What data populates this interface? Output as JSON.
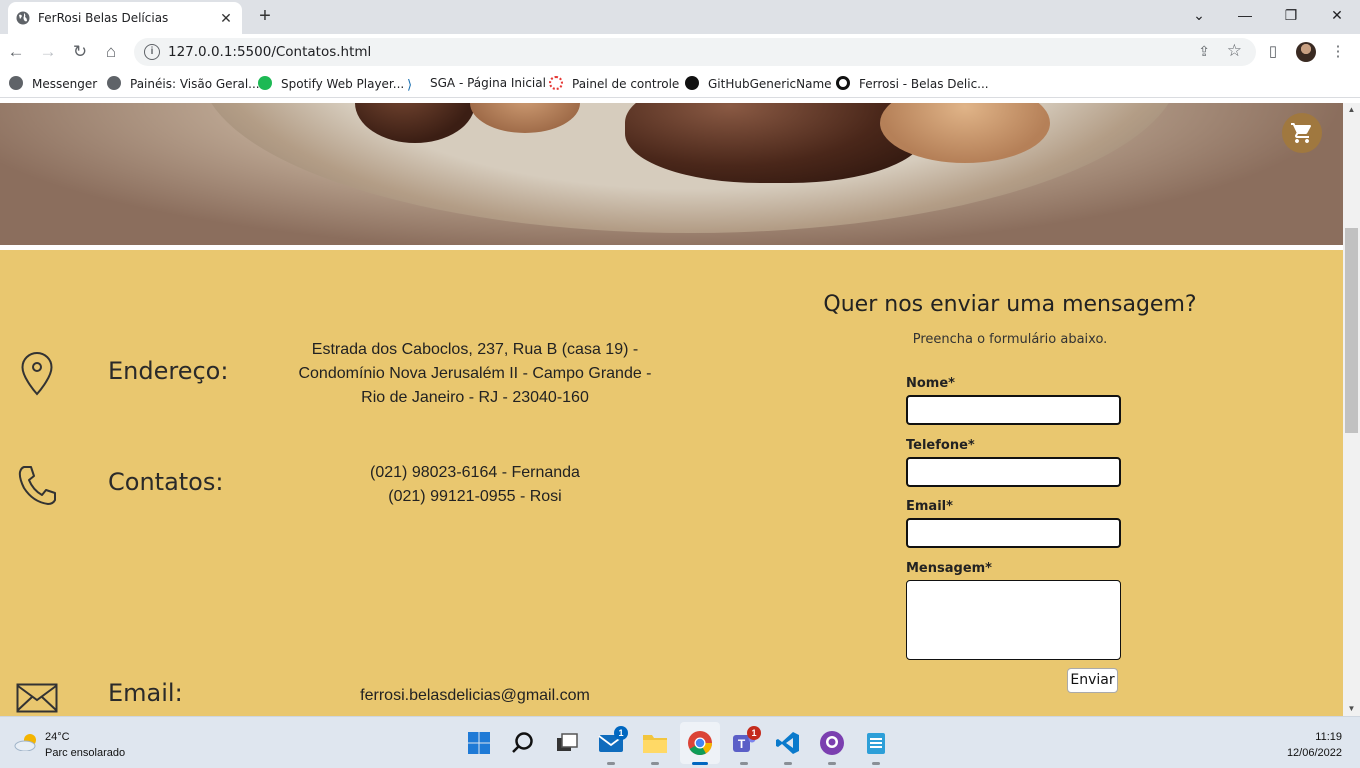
{
  "browser": {
    "tab_title": "FerRosi Belas Delícias",
    "tab_close": "✕",
    "new_tab": "+",
    "url": "127.0.0.1:5500/Contatos.html",
    "window_controls": {
      "dropdown": "⌄",
      "minimize": "—",
      "restore": "❐",
      "close": "✕"
    }
  },
  "bookmarks": [
    {
      "label": "Messenger",
      "icon": "globe-icon",
      "color": "#5f6368"
    },
    {
      "label": "Painéis: Visão Geral...",
      "icon": "globe-icon",
      "color": "#5f6368"
    },
    {
      "label": "Spotify Web Player...",
      "icon": "spotify-icon",
      "color": "#1db954"
    },
    {
      "label": "SGA - Página Inicial",
      "icon": "sga-icon",
      "color": "#1a6fb0"
    },
    {
      "label": "Painel de controle",
      "icon": "dotted-ring-icon",
      "color": "#e53935"
    },
    {
      "label": "GitHubGenericName",
      "icon": "github-icon",
      "color": "#111111"
    },
    {
      "label": "Ferrosi - Belas Delic...",
      "icon": "ferrosi-icon",
      "color": "#111111"
    }
  ],
  "contact": {
    "address_label": "Endereço:",
    "address_value": "Estrada dos Caboclos, 237, Rua B (casa 19) - Condomínio Nova Jerusalém II - Campo Grande - Rio de Janeiro - RJ - 23040-160",
    "phone_label": "Contatos:",
    "phone_line1": "(021) 98023-6164 - Fernanda",
    "phone_line2": "(021) 99121-0955 - Rosi",
    "email_label": "Email:",
    "email_value": "ferrosi.belasdelicias@gmail.com"
  },
  "form": {
    "title": "Quer nos enviar uma mensagem?",
    "subtitle": "Preencha o formulário abaixo.",
    "name_label": "Nome*",
    "phone_label": "Telefone*",
    "email_label": "Email*",
    "message_label": "Mensagem*",
    "submit_label": "Enviar"
  },
  "taskbar": {
    "weather_temp": "24°C",
    "weather_desc": "Parc ensolarado",
    "time": "11:19",
    "date": "12/06/2022",
    "mail_badge": "1",
    "teams_badge": "1"
  },
  "colors": {
    "section_bg": "#e9c76f",
    "cart_button": "#a0783f",
    "text_dark": "#222222"
  }
}
